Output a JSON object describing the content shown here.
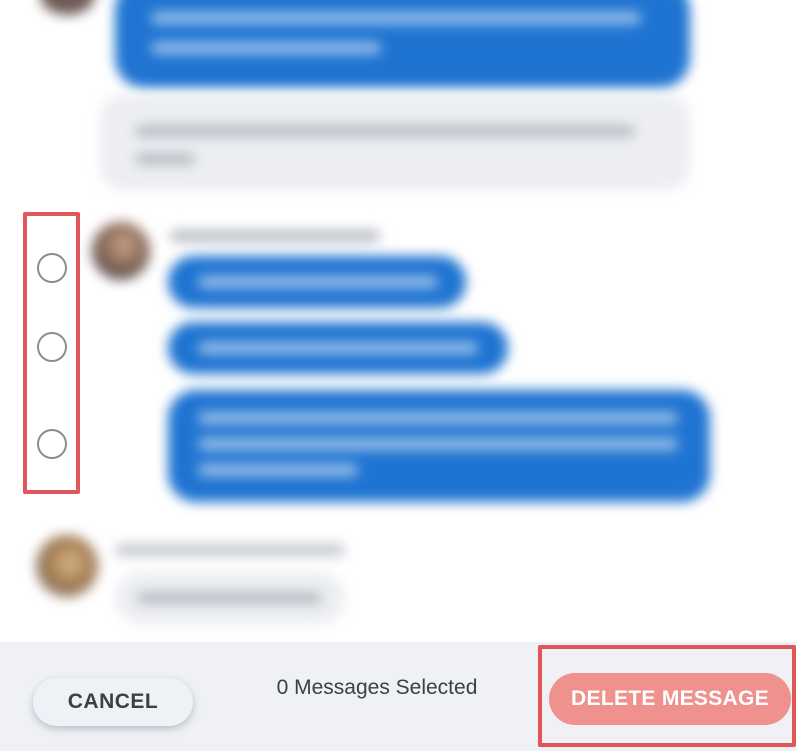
{
  "footer": {
    "cancel_label": "CANCEL",
    "selected_count_text": "0 Messages Selected",
    "delete_label": "DELETE MESSAGE"
  },
  "colors": {
    "highlight": "#e0565b",
    "delete_button": "#ef928d",
    "message_bubble": "#1f74d1"
  },
  "icons": [
    "radio-unchecked-icon",
    "avatar-icon"
  ]
}
